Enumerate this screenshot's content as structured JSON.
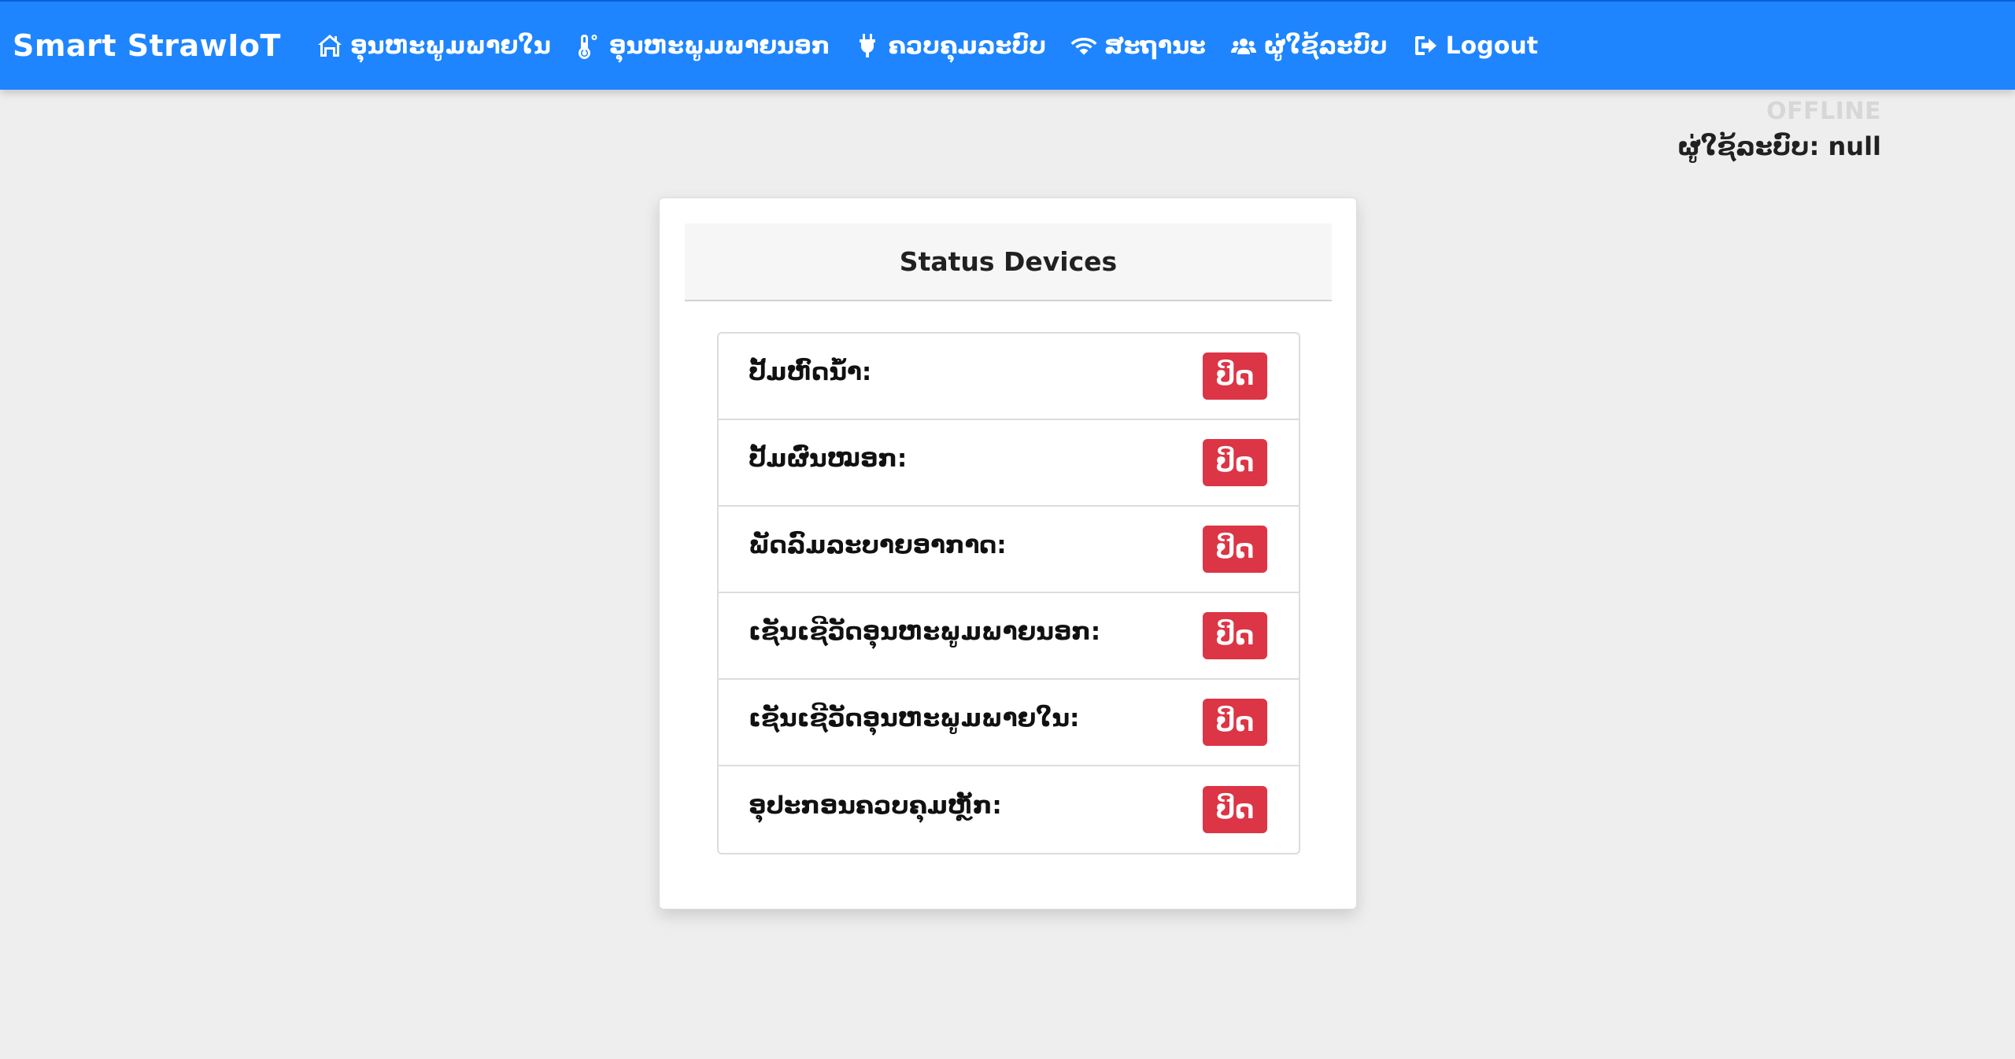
{
  "navbar": {
    "brand": "Smart StrawIoT",
    "items": [
      {
        "label": "ອຸນຫະພູມພາຍໃນ",
        "icon": "home-icon"
      },
      {
        "label": "ອຸນຫະພູມພາຍນອກ",
        "icon": "thermometer-icon"
      },
      {
        "label": "ຄວບຄຸມລະບົບ",
        "icon": "plug-icon"
      },
      {
        "label": "ສະຖານະ",
        "icon": "wifi-icon"
      },
      {
        "label": "ຜູ່ໃຊ້ລະບົບ",
        "icon": "users-icon"
      },
      {
        "label": "Logout",
        "icon": "logout-icon"
      }
    ],
    "color": "#1e85ff"
  },
  "status": {
    "connection": "OFFLINE",
    "user_label": "ຜູ່ໃຊ້ລະບົບ: null"
  },
  "card": {
    "title": "Status Devices",
    "devices": [
      {
        "label": "ປັ້ມຫົດນ້ຳ:",
        "state": "ປິດ"
      },
      {
        "label": "ປັ້ມຜົ່ນໝອກ:",
        "state": "ປິດ"
      },
      {
        "label": "ພັດລົມລະບາຍອາກາດ:",
        "state": "ປິດ"
      },
      {
        "label": "ເຊັນເຊີວັດອຸນຫະພູມພາຍນອກ:",
        "state": "ປິດ"
      },
      {
        "label": "ເຊັນເຊີວັດອຸນຫະພູມພາຍໃນ:",
        "state": "ປິດ"
      },
      {
        "label": "ອຸປະກອນຄວບຄຸມຫຼັກ:",
        "state": "ປິດ"
      }
    ],
    "off_color": "#dc3545"
  }
}
